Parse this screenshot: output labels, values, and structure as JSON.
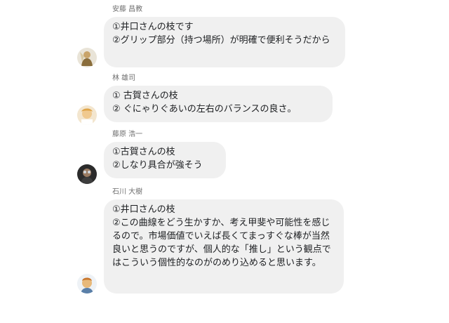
{
  "messages": [
    {
      "sender": "安藤 昌教",
      "text": "①井口さんの枝です\n②グリップ部分（持つ場所）が明確で便利そうだから",
      "avatar_icon": "user-avatar-icon"
    },
    {
      "sender": "林 雄司",
      "text": "① 古賀さんの枝\n② ぐにゃりぐあいの左右のバランスの良さ。",
      "avatar_icon": "user-avatar-icon"
    },
    {
      "sender": "藤原 浩一",
      "text": "①古賀さんの枝\n②しなり具合が強そう",
      "avatar_icon": "user-avatar-icon"
    },
    {
      "sender": "石川 大樹",
      "text": "①井口さんの枝\n②この曲線をどう生かすか、考え甲斐や可能性を感じるので。市場価値でいえば長くてまっすぐな棒が当然良いと思うのですが、個人的な「推し」という観点ではこういう個性的なのがのめり込めると思います。",
      "avatar_icon": "user-avatar-icon"
    }
  ]
}
